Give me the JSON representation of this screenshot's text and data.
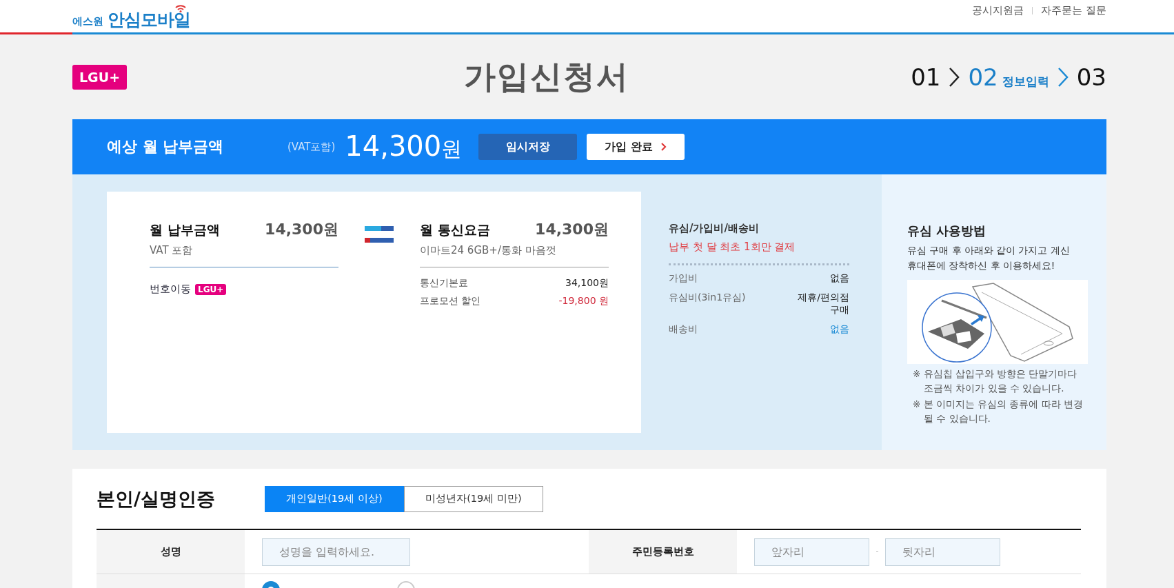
{
  "header": {
    "logo": {
      "subtext": "에스원",
      "text": "안심모바일"
    },
    "links": [
      "공시지원금",
      "자주묻는 질문"
    ]
  },
  "page": {
    "carrier_badge": "LGU+",
    "title": "가입신청서",
    "steps": [
      {
        "number": "01",
        "selected": false
      },
      {
        "number": "02",
        "label": "정보입력",
        "selected": true
      },
      {
        "number": "03",
        "selected": false
      }
    ]
  },
  "summary_bar": {
    "label": "예상 월 납부금액",
    "vat_note": "(VAT포함)",
    "amount": "14,300",
    "unit": "원",
    "buttons": [
      {
        "label": "임시저장",
        "kind": "secondary"
      },
      {
        "label": "가입 완료",
        "kind": "primary"
      }
    ]
  },
  "monthly_payment": {
    "title": "월 납부금액",
    "amount": "14,300원",
    "note": "VAT 포함",
    "transfer_label": "번호이동",
    "carrier_badge": "LGU+"
  },
  "plan": {
    "title": "월 통신요금",
    "amount": "14,300원",
    "name": "이마트24 6GB+/통화 마음껏",
    "rows": [
      {
        "label": "통신기본료",
        "value": "34,100원",
        "kind": "normal"
      },
      {
        "label": "프로모션 할인",
        "value": "-19,800 원",
        "kind": "discount"
      }
    ]
  },
  "fees": {
    "title": "유심/가입비/배송비",
    "notice": "납부 첫 달 최초 1회만 결제",
    "rows": [
      {
        "label": "가입비",
        "value": "없음",
        "kind": "normal"
      },
      {
        "label": "유심비(3in1유심)",
        "value": "제휴/편의점 구매",
        "kind": "normal"
      },
      {
        "label": "배송비",
        "value": "없음",
        "kind": "link"
      }
    ]
  },
  "usim_guide": {
    "title": "유심 사용방법",
    "description": "유심 구매 후 아래와 같이 가지고 계신 휴대폰에 장착하신 후 이용하세요!",
    "notes": [
      "※ 유심칩 삽입구와 방향은 단말기마다 조금씩 차이가 있을 수 있습니다.",
      "※ 본 이미지는 유심의 종류에 따라 변경 될 수 있습니다."
    ]
  },
  "verification": {
    "title": "본인/실명인증",
    "tabs": [
      {
        "label": "개인일반(19세 이상)",
        "selected": true
      },
      {
        "label": "미성년자(19세 미만)",
        "selected": false
      }
    ],
    "name_label": "성명",
    "name_placeholder": "성명을 입력하세요.",
    "id_label": "주민등록번호",
    "id_front_placeholder": "앞자리",
    "id_back_placeholder": "뒷자리",
    "id_types": [
      {
        "selected": true
      },
      {
        "selected": false
      }
    ]
  }
}
